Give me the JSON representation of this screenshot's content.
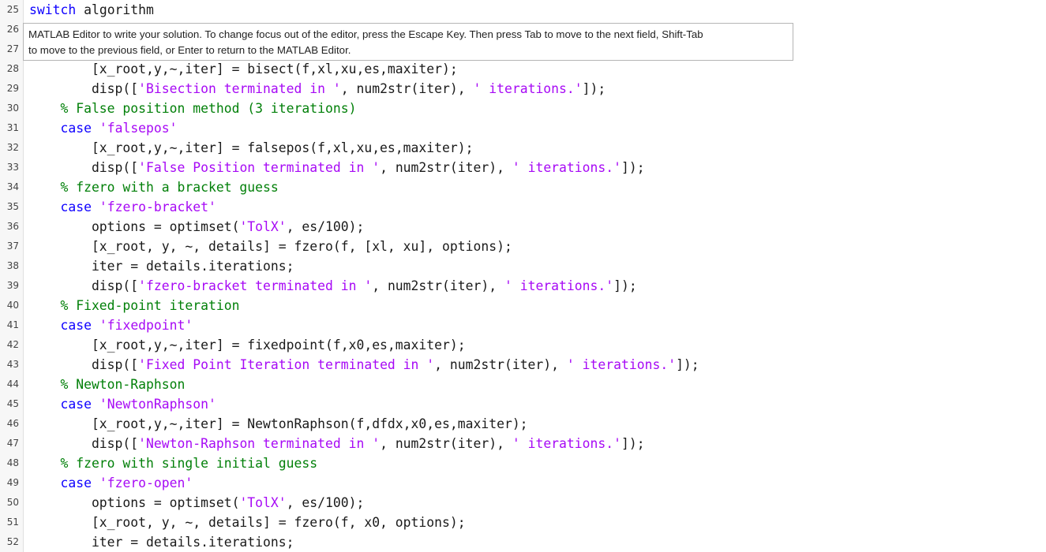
{
  "tooltip": {
    "line1": "MATLAB Editor to write your solution. To change focus out of the editor, press the Escape Key. Then press Tab to move to the next field, Shift-Tab",
    "line2": "to move to the previous field, or Enter to return to the MATLAB Editor."
  },
  "lines": [
    {
      "n": "25",
      "tokens": [
        [
          "kw",
          "switch"
        ],
        [
          "t",
          " algorithm"
        ]
      ]
    },
    {
      "n": "26",
      "tokens": []
    },
    {
      "n": "27",
      "tokens": []
    },
    {
      "n": "28",
      "tokens": [
        [
          "t",
          "        [x_root,y,~,iter] = bisect(f,xl,xu,es,maxiter);"
        ]
      ]
    },
    {
      "n": "29",
      "tokens": [
        [
          "t",
          "        disp(["
        ],
        [
          "str",
          "'Bisection terminated in '"
        ],
        [
          "t",
          ", num2str(iter), "
        ],
        [
          "str",
          "' iterations.'"
        ],
        [
          "t",
          "]);"
        ]
      ]
    },
    {
      "n": "30",
      "tokens": [
        [
          "cm",
          "    % False position method (3 iterations)"
        ]
      ]
    },
    {
      "n": "31",
      "tokens": [
        [
          "t",
          "    "
        ],
        [
          "kw",
          "case"
        ],
        [
          "t",
          " "
        ],
        [
          "str",
          "'falsepos'"
        ]
      ]
    },
    {
      "n": "32",
      "tokens": [
        [
          "t",
          "        [x_root,y,~,iter] = falsepos(f,xl,xu,es,maxiter);"
        ]
      ]
    },
    {
      "n": "33",
      "tokens": [
        [
          "t",
          "        disp(["
        ],
        [
          "str",
          "'False Position terminated in '"
        ],
        [
          "t",
          ", num2str(iter), "
        ],
        [
          "str",
          "' iterations.'"
        ],
        [
          "t",
          "]);"
        ]
      ]
    },
    {
      "n": "34",
      "tokens": [
        [
          "cm",
          "    % fzero with a bracket guess"
        ]
      ]
    },
    {
      "n": "35",
      "tokens": [
        [
          "t",
          "    "
        ],
        [
          "kw",
          "case"
        ],
        [
          "t",
          " "
        ],
        [
          "str",
          "'fzero-bracket'"
        ]
      ]
    },
    {
      "n": "36",
      "tokens": [
        [
          "t",
          "        options = optimset("
        ],
        [
          "str",
          "'TolX'"
        ],
        [
          "t",
          ", es/100);"
        ]
      ]
    },
    {
      "n": "37",
      "tokens": [
        [
          "t",
          "        [x_root, y, ~, details] = fzero(f, [xl, xu], options);"
        ]
      ]
    },
    {
      "n": "38",
      "tokens": [
        [
          "t",
          "        iter = details.iterations;"
        ]
      ]
    },
    {
      "n": "39",
      "tokens": [
        [
          "t",
          "        disp(["
        ],
        [
          "str",
          "'fzero-bracket terminated in '"
        ],
        [
          "t",
          ", num2str(iter), "
        ],
        [
          "str",
          "' iterations.'"
        ],
        [
          "t",
          "]);"
        ]
      ]
    },
    {
      "n": "40",
      "tokens": [
        [
          "cm",
          "    % Fixed-point iteration"
        ]
      ]
    },
    {
      "n": "41",
      "tokens": [
        [
          "t",
          "    "
        ],
        [
          "kw",
          "case"
        ],
        [
          "t",
          " "
        ],
        [
          "str",
          "'fixedpoint'"
        ]
      ]
    },
    {
      "n": "42",
      "tokens": [
        [
          "t",
          "        [x_root,y,~,iter] = fixedpoint(f,x0,es,maxiter);"
        ]
      ]
    },
    {
      "n": "43",
      "tokens": [
        [
          "t",
          "        disp(["
        ],
        [
          "str",
          "'Fixed Point Iteration terminated in '"
        ],
        [
          "t",
          ", num2str(iter), "
        ],
        [
          "str",
          "' iterations.'"
        ],
        [
          "t",
          "]);"
        ]
      ]
    },
    {
      "n": "44",
      "tokens": [
        [
          "cm",
          "    % Newton-Raphson"
        ]
      ]
    },
    {
      "n": "45",
      "tokens": [
        [
          "t",
          "    "
        ],
        [
          "kw",
          "case"
        ],
        [
          "t",
          " "
        ],
        [
          "str",
          "'NewtonRaphson'"
        ]
      ]
    },
    {
      "n": "46",
      "tokens": [
        [
          "t",
          "        [x_root,y,~,iter] = NewtonRaphson(f,dfdx,x0,es,maxiter);"
        ]
      ]
    },
    {
      "n": "47",
      "tokens": [
        [
          "t",
          "        disp(["
        ],
        [
          "str",
          "'Newton-Raphson terminated in '"
        ],
        [
          "t",
          ", num2str(iter), "
        ],
        [
          "str",
          "' iterations.'"
        ],
        [
          "t",
          "]);"
        ]
      ]
    },
    {
      "n": "48",
      "tokens": [
        [
          "cm",
          "    % fzero with single initial guess"
        ]
      ]
    },
    {
      "n": "49",
      "tokens": [
        [
          "t",
          "    "
        ],
        [
          "kw",
          "case"
        ],
        [
          "t",
          " "
        ],
        [
          "str",
          "'fzero-open'"
        ]
      ]
    },
    {
      "n": "50",
      "tokens": [
        [
          "t",
          "        options = optimset("
        ],
        [
          "str",
          "'TolX'"
        ],
        [
          "t",
          ", es/100);"
        ]
      ]
    },
    {
      "n": "51",
      "tokens": [
        [
          "t",
          "        [x_root, y, ~, details] = fzero(f, x0, options);"
        ]
      ]
    },
    {
      "n": "52",
      "tokens": [
        [
          "t",
          "        iter = details.iterations;"
        ]
      ]
    }
  ],
  "colors": {
    "keyword": "#0e00ff",
    "string": "#a709f5",
    "comment": "#028009"
  }
}
